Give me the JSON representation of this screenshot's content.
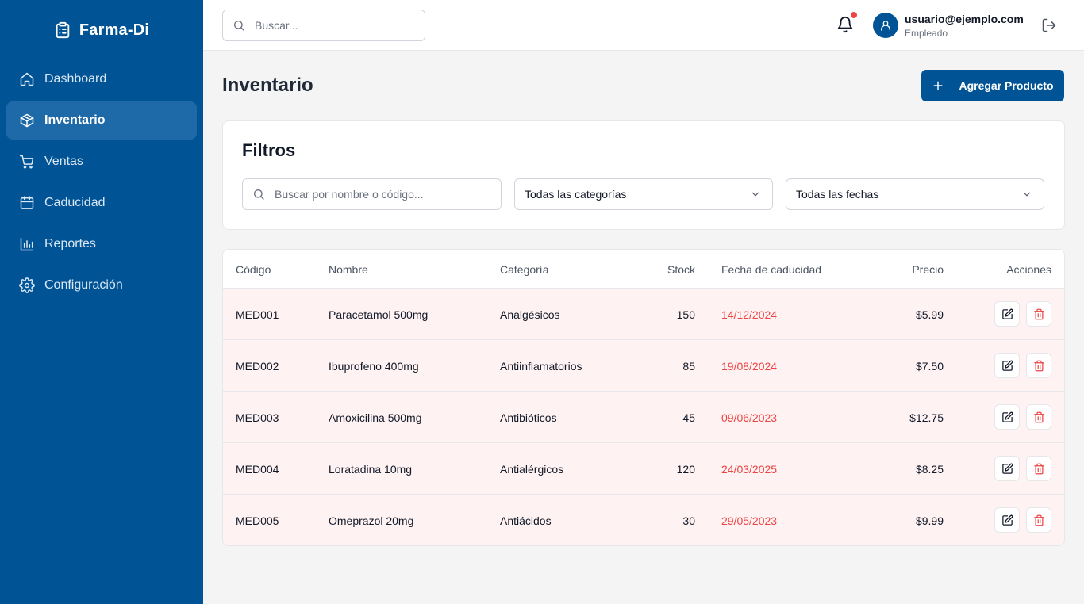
{
  "app": {
    "name": "Farma-Di"
  },
  "sidebar": {
    "items": [
      {
        "label": "Dashboard",
        "icon": "home-icon"
      },
      {
        "label": "Inventario",
        "icon": "package-icon",
        "active": true
      },
      {
        "label": "Ventas",
        "icon": "cart-icon"
      },
      {
        "label": "Caducidad",
        "icon": "calendar-icon"
      },
      {
        "label": "Reportes",
        "icon": "bar-chart-icon"
      },
      {
        "label": "Configuración",
        "icon": "gear-icon"
      }
    ]
  },
  "header": {
    "search_placeholder": "Buscar...",
    "user_email": "usuario@ejemplo.com",
    "user_role": "Empleado"
  },
  "page": {
    "title": "Inventario",
    "add_button": "Agregar Producto"
  },
  "filters": {
    "title": "Filtros",
    "search_placeholder": "Buscar por nombre o código...",
    "category_select": "Todas las categorías",
    "date_select": "Todas las fechas"
  },
  "table": {
    "headers": [
      "Código",
      "Nombre",
      "Categoría",
      "Stock",
      "Fecha de caducidad",
      "Precio",
      "Acciones"
    ],
    "rows": [
      {
        "code": "MED001",
        "name": "Paracetamol 500mg",
        "category": "Analgésicos",
        "stock": "150",
        "expiry": "14/12/2024",
        "price": "$5.99"
      },
      {
        "code": "MED002",
        "name": "Ibuprofeno 400mg",
        "category": "Antiinflamatorios",
        "stock": "85",
        "expiry": "19/08/2024",
        "price": "$7.50"
      },
      {
        "code": "MED003",
        "name": "Amoxicilina 500mg",
        "category": "Antibióticos",
        "stock": "45",
        "expiry": "09/06/2023",
        "price": "$12.75"
      },
      {
        "code": "MED004",
        "name": "Loratadina 10mg",
        "category": "Antialérgicos",
        "stock": "120",
        "expiry": "24/03/2025",
        "price": "$8.25"
      },
      {
        "code": "MED005",
        "name": "Omeprazol 20mg",
        "category": "Antiácidos",
        "stock": "30",
        "expiry": "29/05/2023",
        "price": "$9.99"
      }
    ]
  },
  "colors": {
    "brand": "#005496",
    "sidebar_active": "#1e6aa8",
    "row_highlight": "#fef2f2",
    "expiry_text": "#ef4444",
    "notification_dot": "#ef4444"
  }
}
